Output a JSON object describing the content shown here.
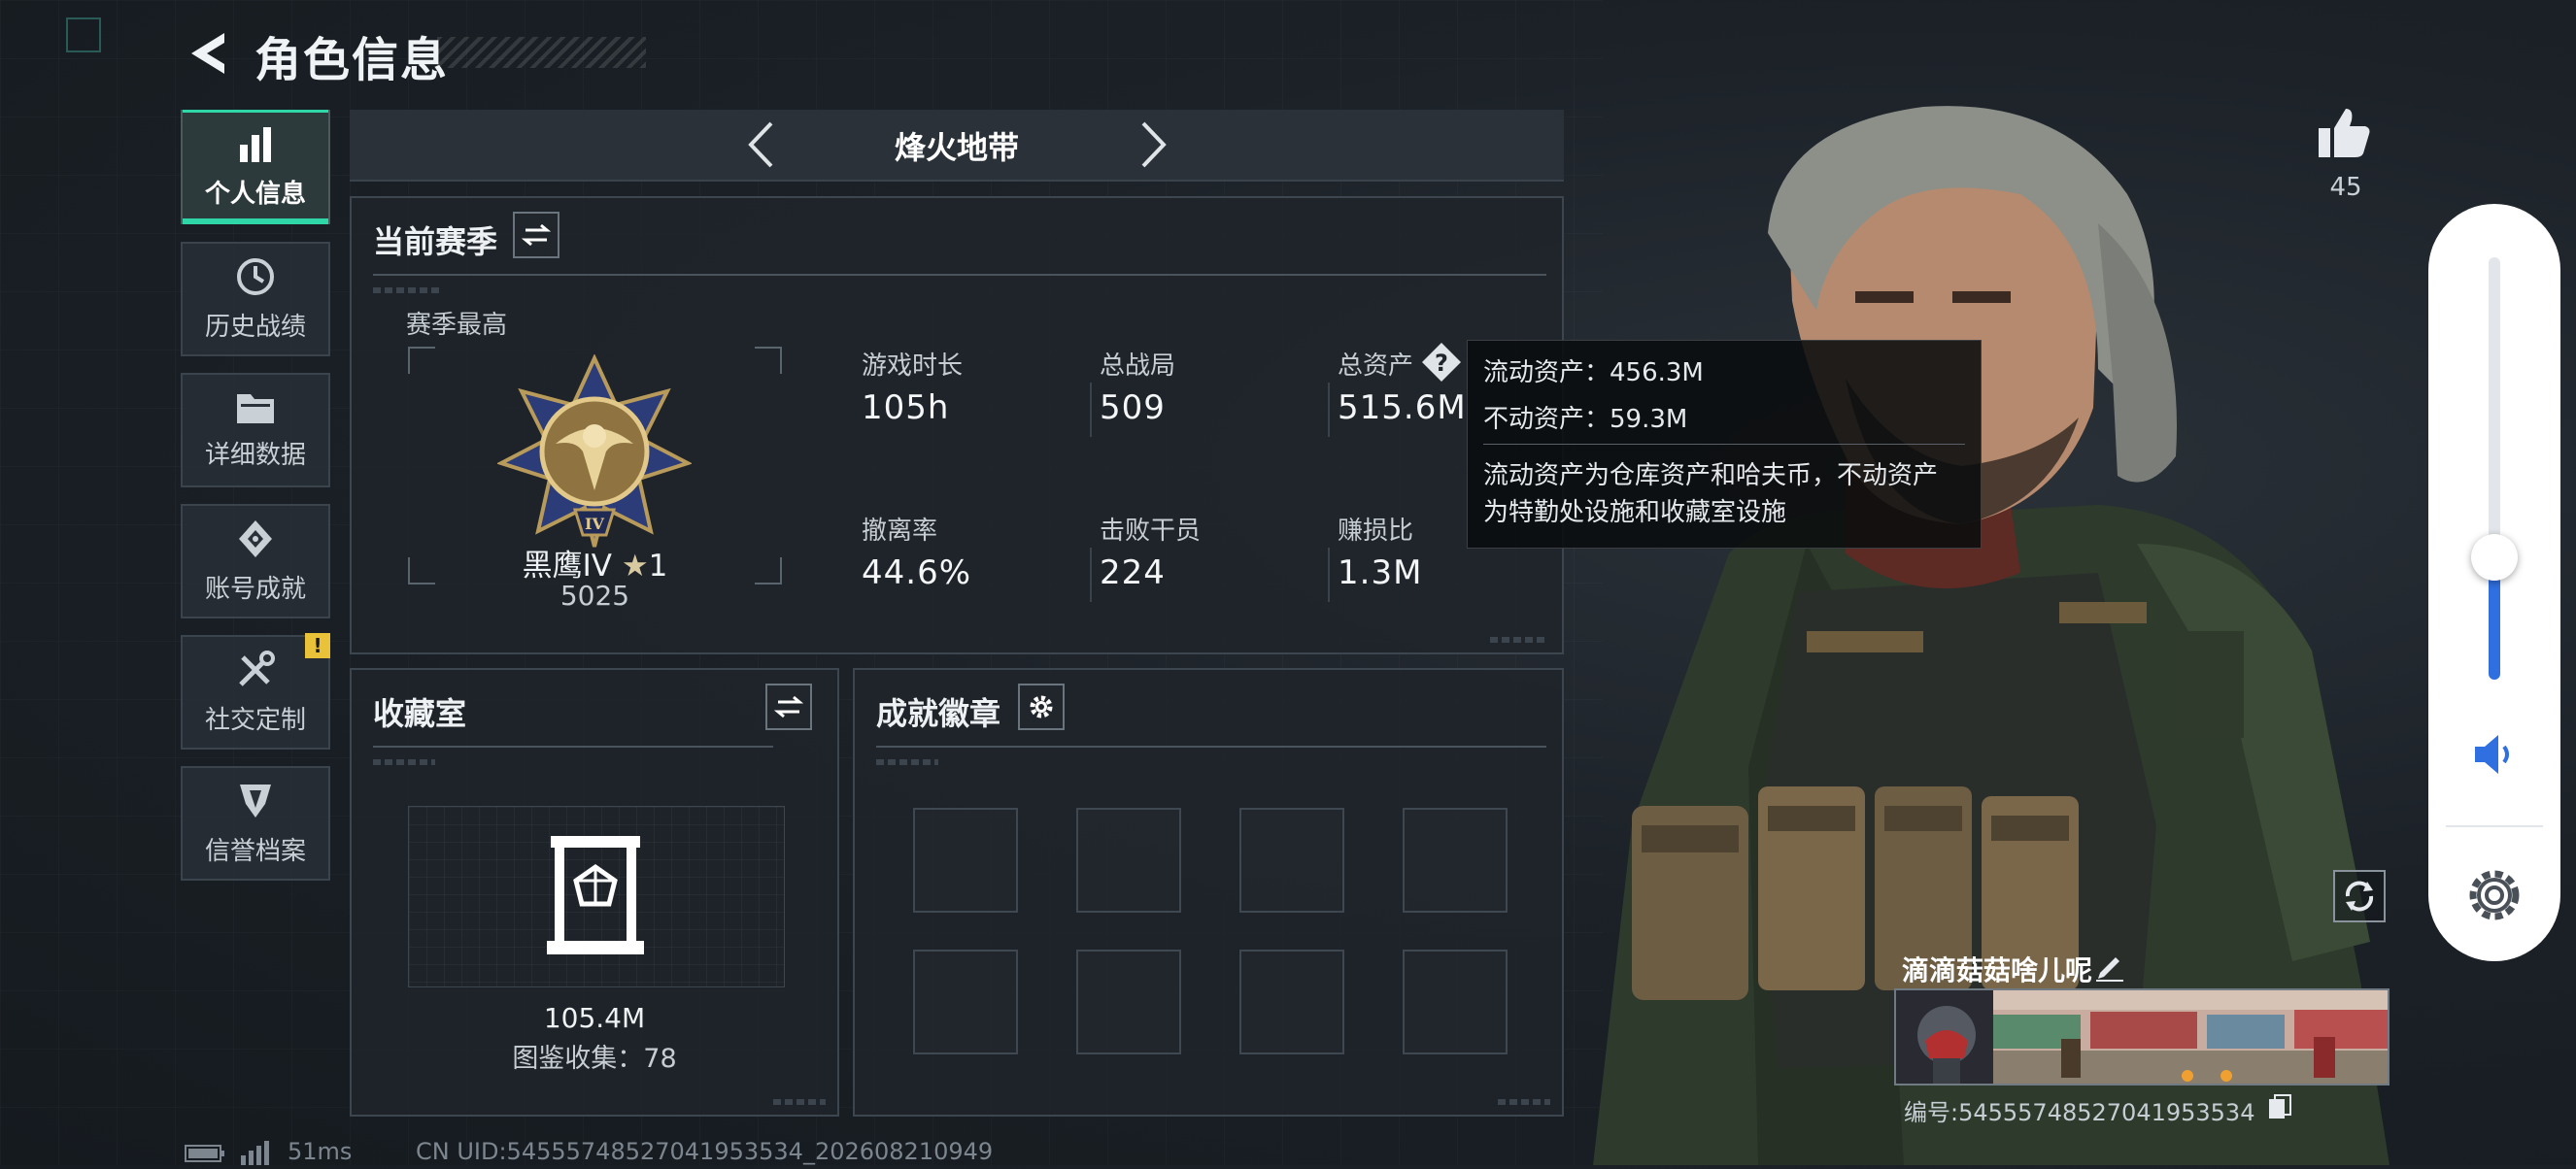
{
  "header": {
    "title": "角色信息"
  },
  "sidebar": {
    "items": [
      {
        "label": "个人信息",
        "icon": "bar-chart-icon",
        "active": true
      },
      {
        "label": "历史战绩",
        "icon": "history-icon"
      },
      {
        "label": "详细数据",
        "icon": "folder-icon"
      },
      {
        "label": "账号成就",
        "icon": "achievement-icon"
      },
      {
        "label": "社交定制",
        "icon": "tools-icon",
        "badge": "!"
      },
      {
        "label": "信誉档案",
        "icon": "shield-icon"
      }
    ]
  },
  "mode": {
    "title": "烽火地带"
  },
  "season": {
    "title": "当前赛季",
    "best_label": "赛季最高",
    "rank_name": "黑鹰IV",
    "rank_star": "1",
    "rank_points": "5025",
    "stats": [
      {
        "label": "游戏时长",
        "value": "105h"
      },
      {
        "label": "总战局",
        "value": "509"
      },
      {
        "label": "总资产",
        "value": "515.6M"
      },
      {
        "label": "撤离率",
        "value": "44.6%"
      },
      {
        "label": "击败干员",
        "value": "224"
      },
      {
        "label": "赚损比",
        "value": "1.3M"
      }
    ]
  },
  "tooltip": {
    "liquid": "流动资产：456.3M",
    "fixed": "不动资产：59.3M",
    "desc_line1": "流动资产为仓库资产和哈夫币，不动资产",
    "desc_line2": "为特勤处设施和收藏室设施"
  },
  "collection": {
    "title": "收藏室",
    "value": "105.4M",
    "count": "图鉴收集：78"
  },
  "achievements": {
    "title": "成就徽章"
  },
  "footer": {
    "ping": "51ms",
    "uid": "CN UID:54555748527041953534_202608210949"
  },
  "likes": {
    "count": "45"
  },
  "player": {
    "name": "滴滴菇菇啥儿呢",
    "id": "编号:54555748527041953534"
  },
  "colors": {
    "accent": "#2fd7a8",
    "warning": "#e9c23a",
    "volume": "#2f6fe0"
  }
}
